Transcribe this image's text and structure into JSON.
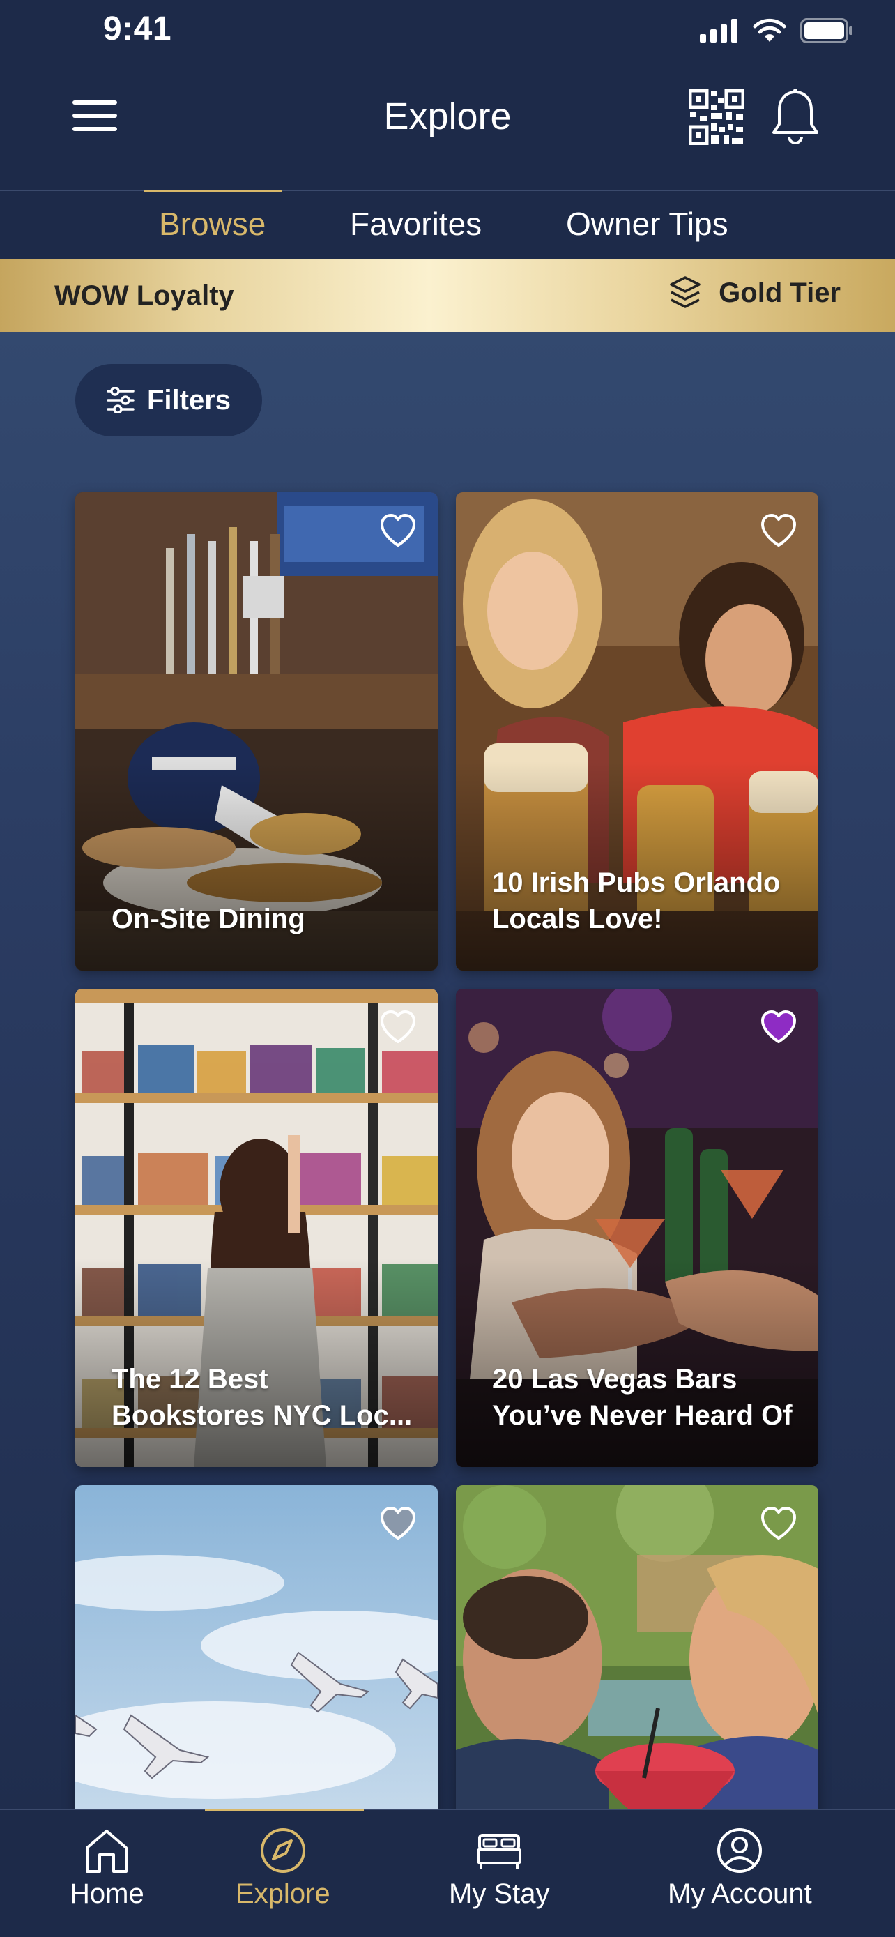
{
  "status": {
    "time": "9:41"
  },
  "header": {
    "title": "Explore"
  },
  "tabs": [
    {
      "label": "Browse",
      "active": true
    },
    {
      "label": "Favorites",
      "active": false
    },
    {
      "label": "Owner Tips",
      "active": false
    }
  ],
  "loyalty": {
    "label": "WOW Loyalty",
    "tier": "Gold Tier"
  },
  "filters": {
    "label": "Filters"
  },
  "cards": [
    {
      "title": "On-Site Dining",
      "favorited": false
    },
    {
      "title": "10 Irish Pubs Orlando\nLocals Love!",
      "favorited": false
    },
    {
      "title": "The 12 Best\nBookstores NYC Loc...",
      "favorited": false
    },
    {
      "title": "20 Las Vegas Bars\nYou’ve Never Heard Of",
      "favorited": true
    },
    {
      "title": "",
      "favorited": false
    },
    {
      "title": "",
      "favorited": false
    }
  ],
  "nav": [
    {
      "label": "Home",
      "active": false
    },
    {
      "label": "Explore",
      "active": true
    },
    {
      "label": "My Stay",
      "active": false
    },
    {
      "label": "My Account",
      "active": false
    }
  ],
  "colors": {
    "accent": "#d8b86a",
    "background": "#1d2a49",
    "favorite": "#8e2cc4"
  }
}
